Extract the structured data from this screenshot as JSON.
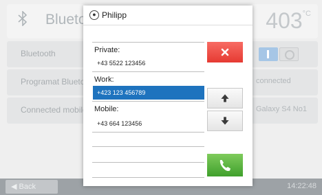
{
  "header": {
    "title": "Bluetooth",
    "temperature": "403",
    "temp_unit": "°C"
  },
  "settings": [
    {
      "label": "Bluetooth",
      "value": ""
    },
    {
      "label": "Programat Bluetooth",
      "value": "connected"
    },
    {
      "label": "Connected mobile",
      "value": "Galaxy S4 No1"
    }
  ],
  "toggle": {
    "state": "on"
  },
  "footer": {
    "back_label": "Back",
    "time": "14:22:48"
  },
  "dialog": {
    "name": "Philipp",
    "contacts": [
      {
        "label": "Private:",
        "number": "+43 5522 123456",
        "selected": false
      },
      {
        "label": "Work:",
        "number": "+423 123 456789",
        "selected": true
      },
      {
        "label": "Mobile:",
        "number": "+43 664 123456",
        "selected": false
      }
    ]
  },
  "icons": {
    "bluetooth": "bluetooth-icon",
    "contact": "contact-icon",
    "close": "close-icon",
    "up": "arrow-up-icon",
    "down": "arrow-down-icon",
    "call": "phone-icon",
    "back": "back-arrow-icon"
  },
  "colors": {
    "selection": "#1e73be",
    "cancel": "#e8453c",
    "call": "#53b23b",
    "toggle_on": "#a6c6e6"
  }
}
